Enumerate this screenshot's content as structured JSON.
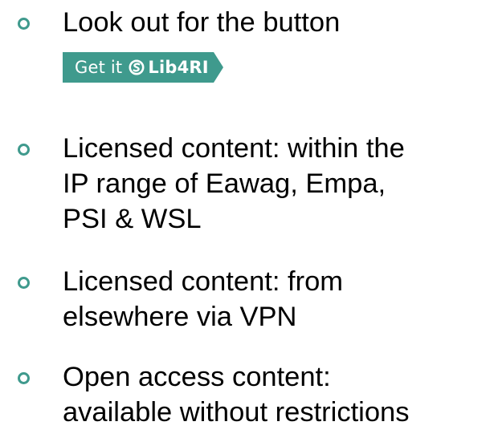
{
  "accent_color": "#3f9a8d",
  "bullets": [
    {
      "text": "Look out for the button"
    },
    {
      "text": "Licensed content: within the\nIP range of Eawag, Empa,\nPSI & WSL"
    },
    {
      "text": "Licensed content: from\nelsewhere via VPN"
    },
    {
      "text": "Open access content:\navailable without restrictions"
    }
  ],
  "getit_button": {
    "label": "Get it",
    "brand": "Lib4RI",
    "icon": "lib4ri-logo-icon"
  }
}
